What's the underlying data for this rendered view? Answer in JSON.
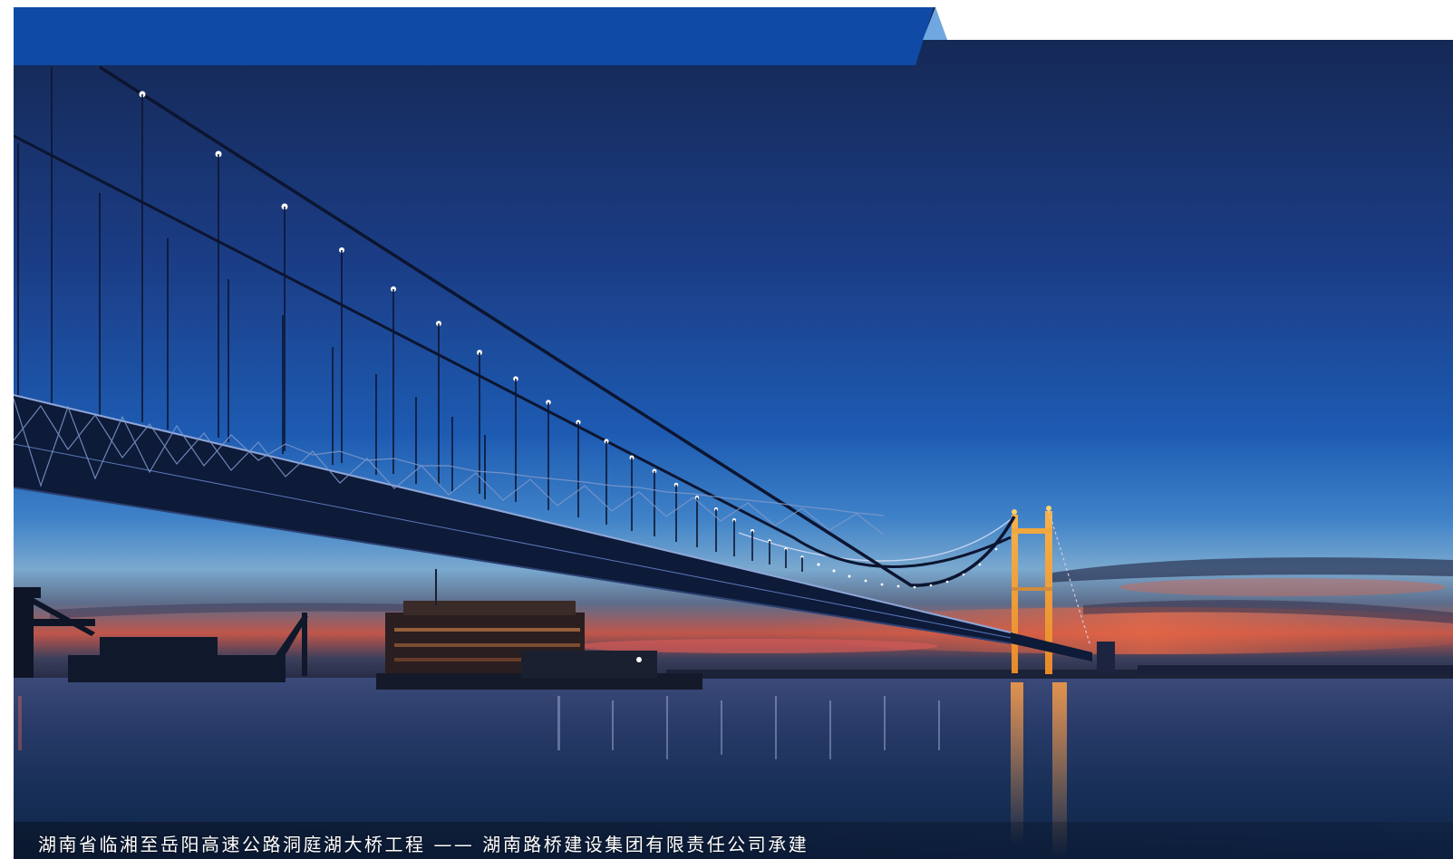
{
  "caption": {
    "text": "湖南省临湘至岳阳高速公路洞庭湖大桥工程 —— 湖南路桥建设集团有限责任公司承建"
  },
  "colors": {
    "banner_blue": "#0f4aa6",
    "banner_accent": "#6fa8e0",
    "sky_top": "#16285a",
    "sky_mid": "#1a57b0",
    "sunset": "#e65a3a"
  },
  "scene": {
    "subject": "suspension-bridge-at-dusk"
  }
}
